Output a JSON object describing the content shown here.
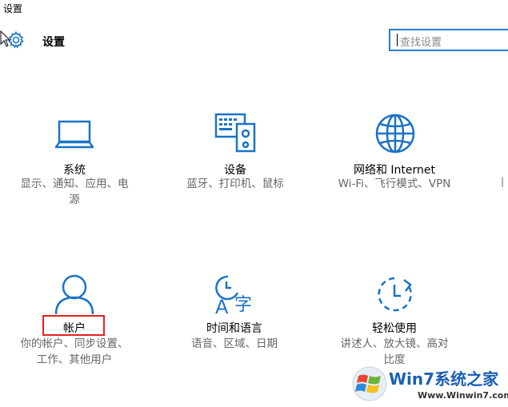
{
  "window": {
    "title": "设置"
  },
  "header": {
    "title": "设置",
    "gear_icon": "gear-icon"
  },
  "search": {
    "placeholder": "查找设置"
  },
  "tiles": [
    {
      "name": "系统",
      "desc1": "显示、通知、应用、电",
      "desc2": "源",
      "icon": "laptop-icon"
    },
    {
      "name": "设备",
      "desc1": "蓝牙、打印机、鼠标",
      "desc2": "",
      "icon": "devices-icon"
    },
    {
      "name": "网络和 Internet",
      "desc1": "Wi-Fi、飞行模式、VPN",
      "desc2": "",
      "icon": "globe-icon"
    },
    {
      "name": "帐户",
      "desc1": "你的帐户、同步设置、",
      "desc2": "工作、其他用户",
      "icon": "person-icon"
    },
    {
      "name": "时间和语言",
      "desc1": "语音、区域、日期",
      "desc2": "",
      "icon": "time-language-icon"
    },
    {
      "name": "轻松使用",
      "desc1": "讲述人、放大镜、高对",
      "desc2": "比度",
      "icon": "ease-of-access-icon"
    }
  ],
  "colors": {
    "accent": "#1a73c7",
    "highlight_border": "#e32121"
  },
  "watermark": {
    "brand": "Win7系统之家",
    "url": "Www.Winwin7.com"
  }
}
